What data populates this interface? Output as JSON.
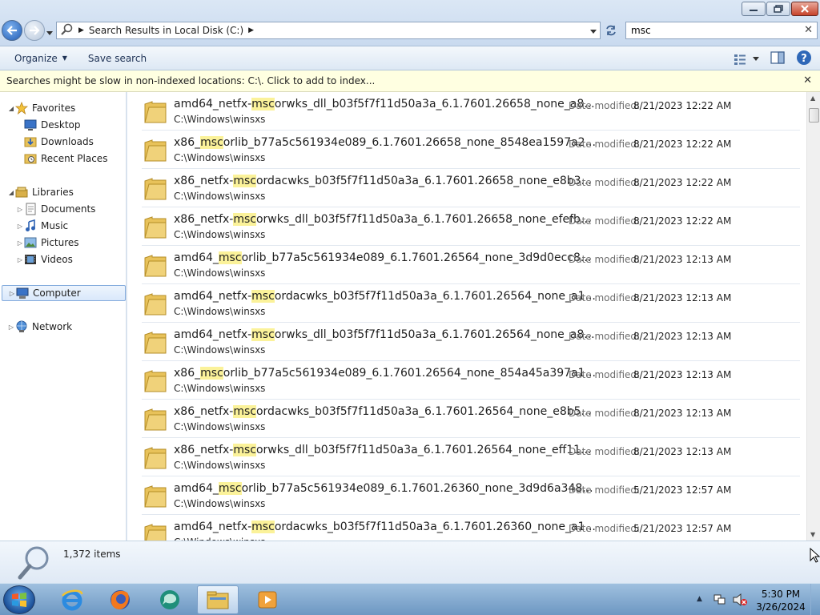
{
  "address": {
    "location": "Search Results in Local Disk (C:)"
  },
  "search": {
    "value": "msc"
  },
  "toolbar": {
    "organize": "Organize",
    "save_search": "Save search"
  },
  "infobar": {
    "message": "Searches might be slow in non-indexed locations: C:\\. Click to add to index..."
  },
  "nav": {
    "favorites": "Favorites",
    "desktop": "Desktop",
    "downloads": "Downloads",
    "recent": "Recent Places",
    "libraries": "Libraries",
    "documents": "Documents",
    "music": "Music",
    "pictures": "Pictures",
    "videos": "Videos",
    "computer": "Computer",
    "network": "Network"
  },
  "results": {
    "date_label": "Date modified:",
    "items": [
      {
        "pre": "amd64_netfx-",
        "hl": "msc",
        "post": "orwks_dll_b03f5f7f11d50a3a_6.1.7601.26658_none_a8...",
        "path": "C:\\Windows\\winsxs",
        "date": "8/21/2023 12:22 AM"
      },
      {
        "pre": "x86_",
        "hl": "msc",
        "post": "orlib_b77a5c561934e089_6.1.7601.26658_none_8548ea1597a2...",
        "path": "C:\\Windows\\winsxs",
        "date": "8/21/2023 12:22 AM"
      },
      {
        "pre": "x86_netfx-",
        "hl": "msc",
        "post": "ordacwks_b03f5f7f11d50a3a_6.1.7601.26658_none_e8b3...",
        "path": "C:\\Windows\\winsxs",
        "date": "8/21/2023 12:22 AM"
      },
      {
        "pre": "x86_netfx-",
        "hl": "msc",
        "post": "orwks_dll_b03f5f7f11d50a3a_6.1.7601.26658_none_efefb...",
        "path": "C:\\Windows\\winsxs",
        "date": "8/21/2023 12:22 AM"
      },
      {
        "pre": "amd64_",
        "hl": "msc",
        "post": "orlib_b77a5c561934e089_6.1.7601.26564_none_3d9d0ecc8...",
        "path": "C:\\Windows\\winsxs",
        "date": "8/21/2023 12:13 AM"
      },
      {
        "pre": "amd64_netfx-",
        "hl": "msc",
        "post": "ordacwks_b03f5f7f11d50a3a_6.1.7601.26564_none_a1...",
        "path": "C:\\Windows\\winsxs",
        "date": "8/21/2023 12:13 AM"
      },
      {
        "pre": "amd64_netfx-",
        "hl": "msc",
        "post": "orwks_dll_b03f5f7f11d50a3a_6.1.7601.26564_none_a8...",
        "path": "C:\\Windows\\winsxs",
        "date": "8/21/2023 12:13 AM"
      },
      {
        "pre": "x86_",
        "hl": "msc",
        "post": "orlib_b77a5c561934e089_6.1.7601.26564_none_854a45a397a1...",
        "path": "C:\\Windows\\winsxs",
        "date": "8/21/2023 12:13 AM"
      },
      {
        "pre": "x86_netfx-",
        "hl": "msc",
        "post": "ordacwks_b03f5f7f11d50a3a_6.1.7601.26564_none_e8b5...",
        "path": "C:\\Windows\\winsxs",
        "date": "8/21/2023 12:13 AM"
      },
      {
        "pre": "x86_netfx-",
        "hl": "msc",
        "post": "orwks_dll_b03f5f7f11d50a3a_6.1.7601.26564_none_eff11...",
        "path": "C:\\Windows\\winsxs",
        "date": "8/21/2023 12:13 AM"
      },
      {
        "pre": "amd64_",
        "hl": "msc",
        "post": "orlib_b77a5c561934e089_6.1.7601.26360_none_3d9d6a348...",
        "path": "C:\\Windows\\winsxs",
        "date": "5/21/2023 12:57 AM"
      },
      {
        "pre": "amd64_netfx-",
        "hl": "msc",
        "post": "ordacwks_b03f5f7f11d50a3a_6.1.7601.26360_none_a1...",
        "path": "C:\\Windows\\winsxs",
        "date": "5/21/2023 12:57 AM"
      }
    ]
  },
  "details": {
    "count": "1,372 items"
  },
  "clock": {
    "time": "5:30 PM",
    "date": "3/26/2024"
  },
  "colors": {
    "highlight": "#fbf29a",
    "infobar": "#ffffe1",
    "folder": "#e8c25a"
  }
}
